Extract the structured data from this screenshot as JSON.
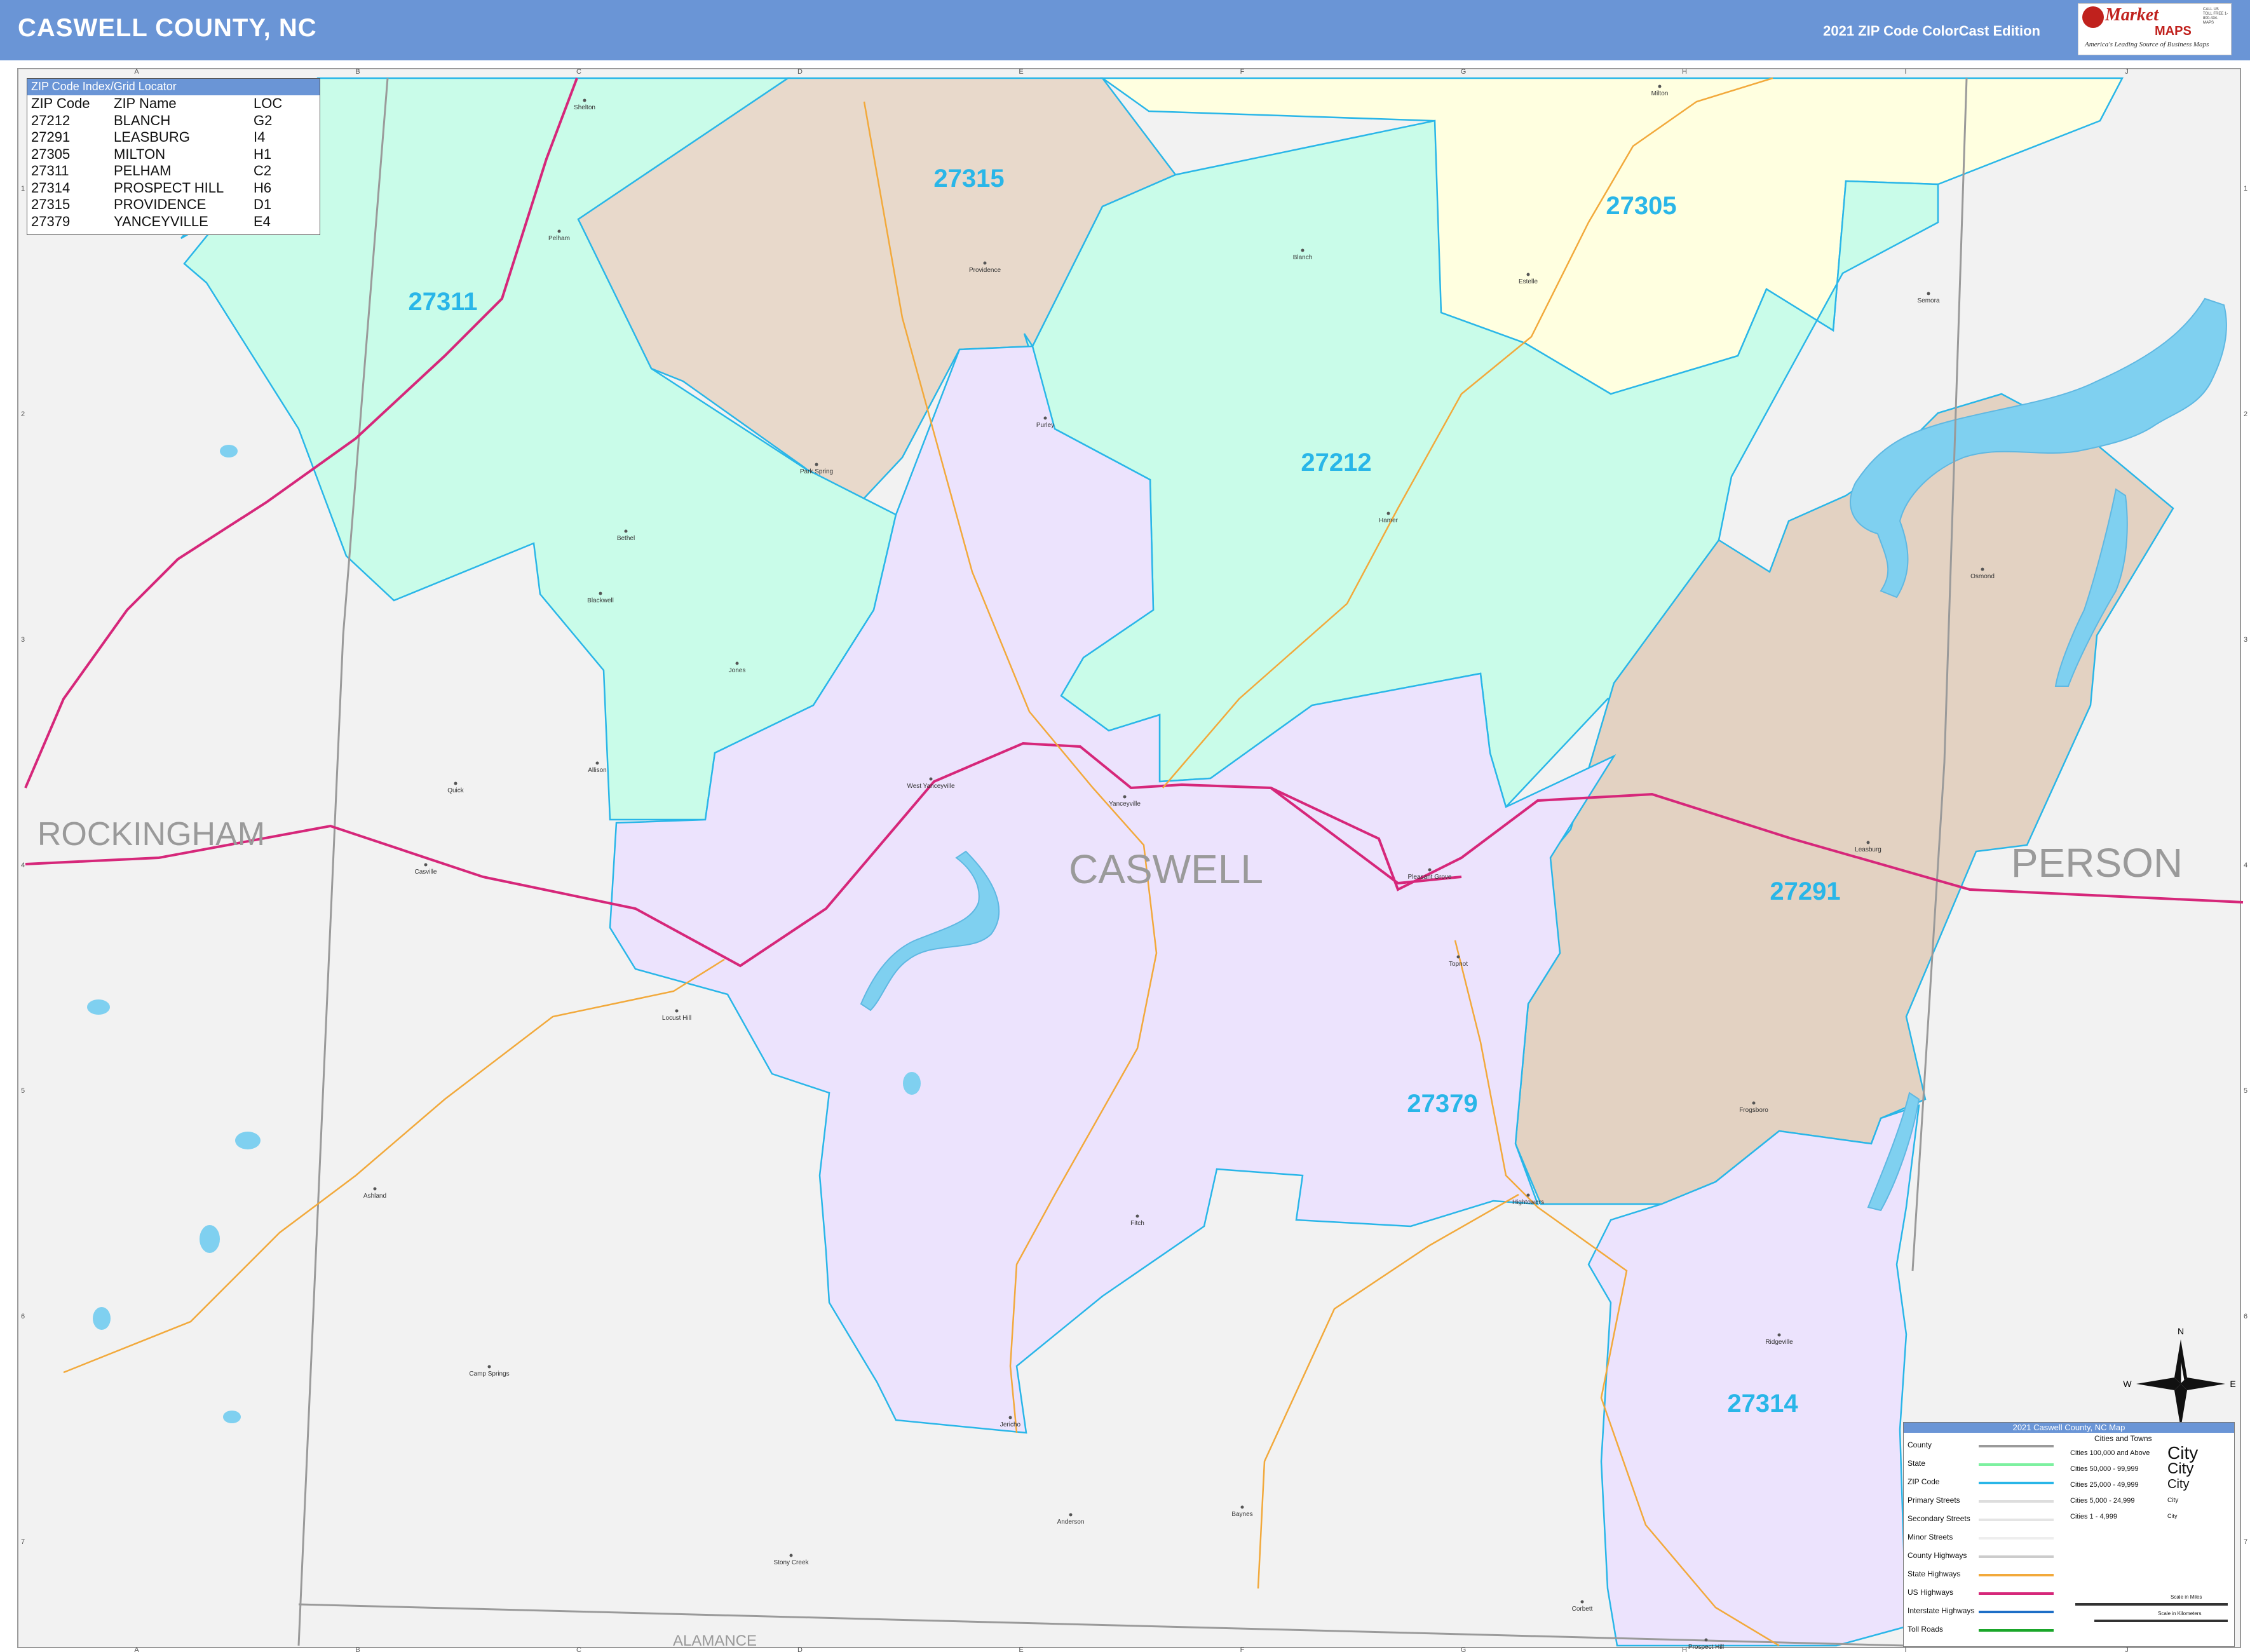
{
  "header": {
    "title": "CASWELL COUNTY, NC",
    "edition": "2021 ZIP Code ColorCast Edition",
    "logo_word1": "Market",
    "logo_word2": "MAPS",
    "logo_tagline": "America's Leading Source of Business Maps",
    "logo_contact": "CALL US TOLL FREE 1-800-434-MAPS"
  },
  "index_table": {
    "title": "ZIP Code Index/Grid Locator",
    "columns": [
      "ZIP Code",
      "ZIP Name",
      "LOC"
    ],
    "rows": [
      [
        "27212",
        "BLANCH",
        "G2"
      ],
      [
        "27291",
        "LEASBURG",
        "I4"
      ],
      [
        "27305",
        "MILTON",
        "H1"
      ],
      [
        "27311",
        "PELHAM",
        "C2"
      ],
      [
        "27314",
        "PROSPECT HILL",
        "H6"
      ],
      [
        "27315",
        "PROVIDENCE",
        "D1"
      ],
      [
        "27379",
        "YANCEYVILLE",
        "E4"
      ]
    ]
  },
  "zip_labels": [
    "27315",
    "27305",
    "27311",
    "27212",
    "27291",
    "27379",
    "27314"
  ],
  "zip_colors": {
    "27315": "#e8d9cb",
    "27305": "#ffffe0",
    "27311": "#c9fce9",
    "27212": "#c9fce9",
    "27291": "#e3d2c2",
    "27379": "#ece3fd",
    "27314": "#ece3fd"
  },
  "region_labels": [
    "ROCKINGHAM",
    "CASWELL",
    "PERSON",
    "ALAMANCE"
  ],
  "places": [
    "Milton",
    "Shelton",
    "Pelham",
    "Providence",
    "Blanch",
    "Estelle",
    "Semora",
    "Park Spring",
    "Purley",
    "Bethel",
    "Hamer",
    "Blackwell",
    "Osmond",
    "Jones",
    "Yanceyville",
    "West Yanceyville",
    "Allison",
    "Quick",
    "Casville",
    "Pleasant Grove",
    "Leasburg",
    "Topnot",
    "Locust Hill",
    "Fitch",
    "Ashland",
    "Hightowers",
    "Prospect Hill",
    "Ridgeville",
    "Camp Springs",
    "Jericho",
    "Anderson",
    "Baynes",
    "Stony Creek",
    "Corbett",
    "Frogsboro"
  ],
  "grid_columns": [
    "A",
    "B",
    "C",
    "D",
    "E",
    "F",
    "G",
    "H",
    "I",
    "J"
  ],
  "grid_rows": [
    "1",
    "2",
    "3",
    "4",
    "5",
    "6",
    "7"
  ],
  "compass": {
    "n": "N",
    "s": "S",
    "e": "E",
    "w": "W"
  },
  "legend": {
    "title": "2021 Caswell County, NC Map",
    "line_items": [
      "County",
      "State",
      "ZIP Code",
      "Primary Streets",
      "Secondary Streets",
      "Minor Streets",
      "County Highways",
      "State Highways",
      "US Highways",
      "Interstate Highways",
      "Toll Roads"
    ],
    "city_title": "Cities and Towns",
    "city_items": [
      "Cities 100,000 and Above",
      "Cities 50,000 - 99,999",
      "Cities 25,000 - 49,999",
      "Cities 5,000 - 24,999",
      "Cities 1 - 4,999"
    ],
    "city_samples": [
      "City",
      "City",
      "City",
      "City",
      "City"
    ],
    "scale_miles": "Scale in Miles",
    "scale_km": "Scale in Kilometers"
  },
  "colors": {
    "header": "#6a95d6",
    "zip_boundary": "#29b6e8",
    "zip_label": "#29b6e8",
    "us_highway": "#d6277a",
    "state_highway": "#f2a93b",
    "water": "#7fd0f0",
    "outside_county": "#f2f2f2"
  }
}
